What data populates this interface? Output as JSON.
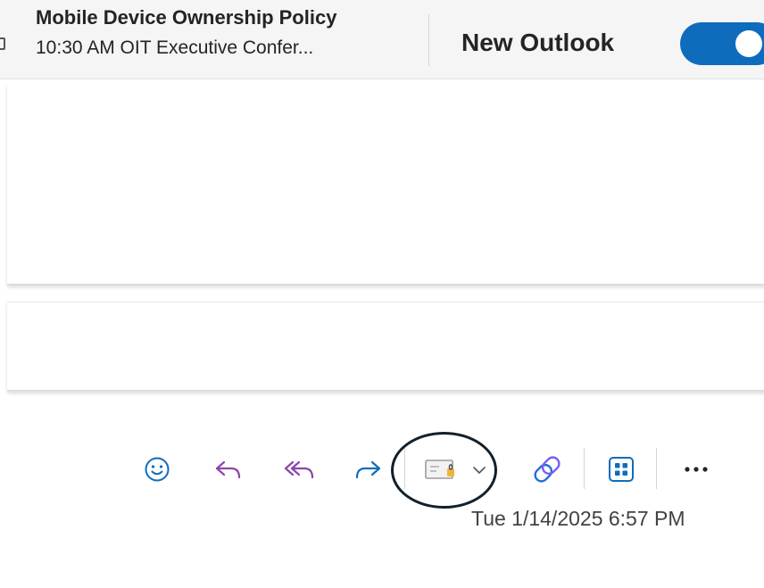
{
  "reminder": {
    "title": "Mobile Device Ownership Policy",
    "subtitle": "10:30 AM OIT Executive Confer..."
  },
  "new_outlook": {
    "label": "New Outlook",
    "toggle_on": true,
    "toggle_color": "#0f6cbd"
  },
  "toolbar": {
    "icons": [
      "emoji-react-icon",
      "reply-icon",
      "reply-all-icon",
      "forward-icon",
      "sensitivity-label-icon",
      "chevron-down-icon",
      "loop-icon",
      "apps-icon",
      "more-actions-icon"
    ],
    "reply_color": "#8e44ad",
    "forward_color": "#0f6cbd"
  },
  "message": {
    "timestamp": "Tue 1/14/2025 6:57 PM"
  }
}
